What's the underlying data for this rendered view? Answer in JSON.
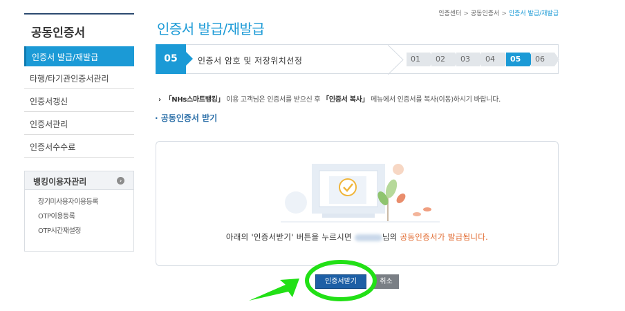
{
  "sidebar": {
    "title": "공동인증서",
    "items": [
      {
        "label": "인증서 발급/재발급"
      },
      {
        "label": "타행/타기관인증서관리"
      },
      {
        "label": "인증서갱신"
      },
      {
        "label": "인증서관리"
      },
      {
        "label": "인증서수수료"
      }
    ],
    "sub_title": "뱅킹이용자관리",
    "sub_items": [
      {
        "label": "장기미사용자이용등록"
      },
      {
        "label": "OTP이용등록"
      },
      {
        "label": "OTP시간재설정"
      }
    ]
  },
  "breadcrumb": [
    "인증센터",
    "공동인증서",
    "인증서 발급/재발급"
  ],
  "page_title": "인증서 발급/재발급",
  "stepbar": {
    "current_number": "05",
    "current_label": "인증서 암호 및 저장위치선정",
    "steps": [
      "01",
      "02",
      "03",
      "04",
      "05",
      "06"
    ],
    "active_step": "05"
  },
  "notice": {
    "bullet": "›",
    "service": "「NHs스마트뱅킹」",
    "text1": " 이용 고객님은 인증서를 받으신 후 ",
    "menu": "「인증서 복사」",
    "text2": " 메뉴에서 인증서를 복사(이동)하시기 바랍니다."
  },
  "section_head": "· 공동인증서 받기",
  "message": {
    "part1": "아래의 '인증서받기' 버튼을 누르시면 ",
    "part2": "님의 ",
    "highlight": "공동인증서가 발급됩니다."
  },
  "buttons": {
    "issue": "인증서받기",
    "cancel": "취소"
  },
  "colors": {
    "accent": "#1b9ad6",
    "highlight": "#e0662a",
    "annotation": "#22e016"
  }
}
